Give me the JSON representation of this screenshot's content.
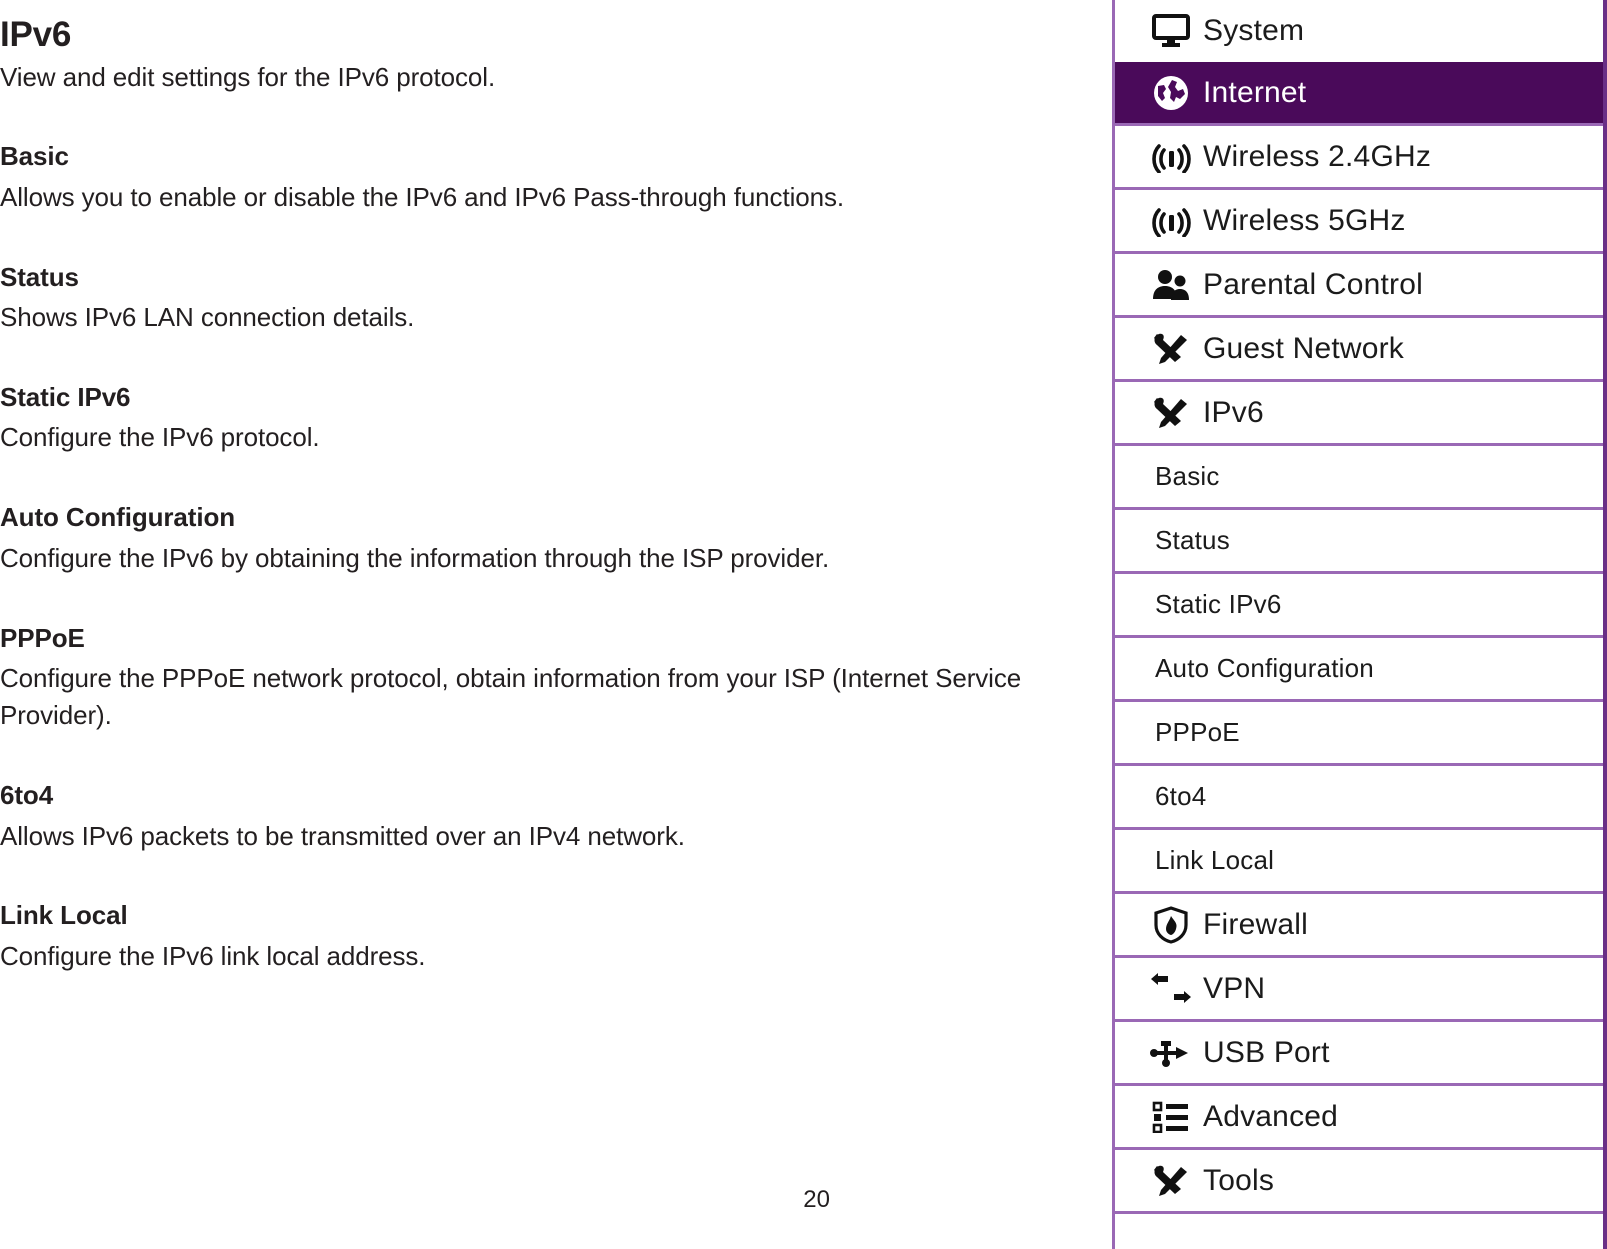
{
  "document": {
    "title": "IPv6",
    "intro": "View and edit settings for the IPv6 protocol.",
    "page_number": "20",
    "sections": [
      {
        "heading": "Basic",
        "body": "Allows you to enable or disable the IPv6 and IPv6 Pass-through functions."
      },
      {
        "heading": "Status",
        "body": "Shows IPv6 LAN connection details."
      },
      {
        "heading": "Static IPv6",
        "body": "Configure the IPv6 protocol."
      },
      {
        "heading": "Auto Configuration",
        "body": "Configure the IPv6 by obtaining the information through the ISP provider."
      },
      {
        "heading": "PPPoE",
        "body": "Configure the PPPoE network protocol, obtain information from your ISP (Internet Service Provider)."
      },
      {
        "heading": "6to4",
        "body": "Allows IPv6 packets to be transmitted over an IPv4 network."
      },
      {
        "heading": "Link Local",
        "body": "Configure the IPv6 link local address."
      }
    ]
  },
  "nav": {
    "active_color": "#4a0a5a",
    "separator_color": "#9a68b5",
    "items": [
      {
        "label": "System",
        "icon": "monitor-icon",
        "level": "main",
        "active": false
      },
      {
        "label": "Internet",
        "icon": "globe-icon",
        "level": "main",
        "active": true
      },
      {
        "label": "Wireless 2.4GHz",
        "icon": "wireless-signal-icon",
        "level": "main",
        "active": false
      },
      {
        "label": "Wireless 5GHz",
        "icon": "wireless-signal-icon",
        "level": "main",
        "active": false
      },
      {
        "label": "Parental Control",
        "icon": "people-icon",
        "level": "main",
        "active": false
      },
      {
        "label": "Guest Network",
        "icon": "tools-icon",
        "level": "main",
        "active": false
      },
      {
        "label": "IPv6",
        "icon": "tools-icon",
        "level": "main",
        "active": false
      },
      {
        "label": "Basic",
        "icon": "",
        "level": "sub",
        "active": false
      },
      {
        "label": "Status",
        "icon": "",
        "level": "sub",
        "active": false
      },
      {
        "label": "Static IPv6",
        "icon": "",
        "level": "sub",
        "active": false
      },
      {
        "label": "Auto Configuration",
        "icon": "",
        "level": "sub",
        "active": false
      },
      {
        "label": "PPPoE",
        "icon": "",
        "level": "sub",
        "active": false
      },
      {
        "label": "6to4",
        "icon": "",
        "level": "sub",
        "active": false
      },
      {
        "label": "Link Local",
        "icon": "",
        "level": "sub",
        "active": false
      },
      {
        "label": "Firewall",
        "icon": "shield-flame-icon",
        "level": "main",
        "active": false
      },
      {
        "label": "VPN",
        "icon": "exchange-arrows-icon",
        "level": "main",
        "active": false
      },
      {
        "label": "USB Port",
        "icon": "usb-icon",
        "level": "main",
        "active": false
      },
      {
        "label": "Advanced",
        "icon": "list-icon",
        "level": "main",
        "active": false
      },
      {
        "label": "Tools",
        "icon": "tools-icon",
        "level": "main",
        "active": false
      }
    ]
  }
}
